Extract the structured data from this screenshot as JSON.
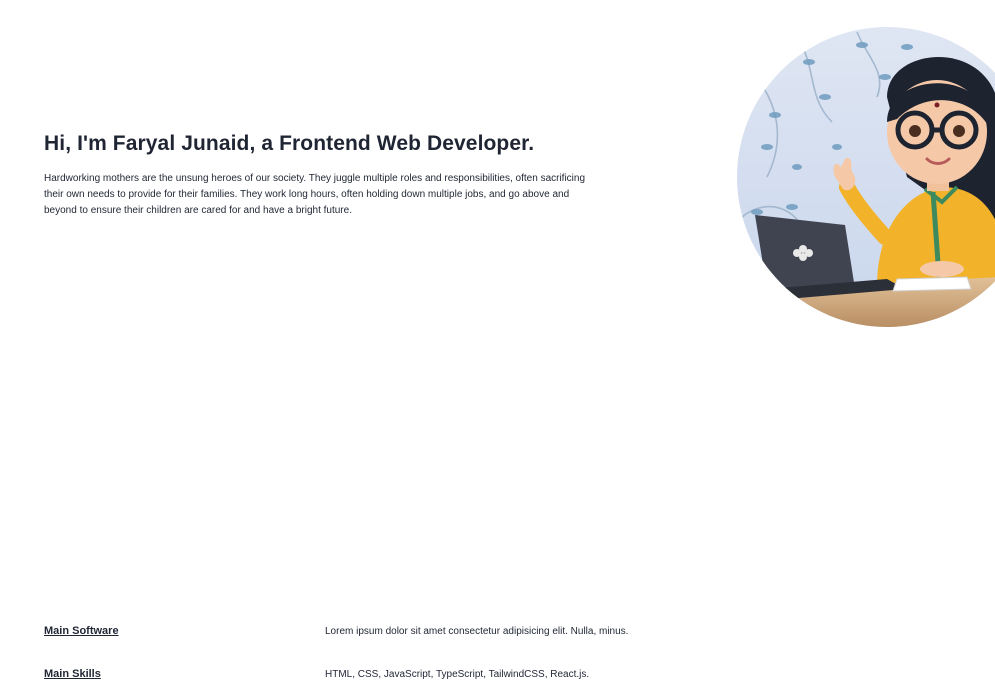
{
  "hero": {
    "title": "Hi, I'm Faryal Junaid, a Frontend Web Developer.",
    "description": "Hardworking mothers are the unsung heroes of our society. They juggle multiple roles and responsibilities, often sacrificing their own needs to provide for their families. They work long hours, often holding down multiple jobs, and go above and beyond to ensure their children are cared for and have a bright future.",
    "image_icon": "avatar-illustration"
  },
  "info": [
    {
      "label": "Main Software",
      "value": "Lorem ipsum dolor sit amet consectetur adipisicing elit. Nulla, minus."
    },
    {
      "label": "Main Skills",
      "value": "HTML, CSS, JavaScript, TypeScript, TailwindCSS, React.js."
    }
  ],
  "colors": {
    "text": "#1f2533",
    "background": "#ffffff",
    "shirt": "#f2b22a",
    "laptop": "#3f4450",
    "desk": "#d9b48a"
  }
}
